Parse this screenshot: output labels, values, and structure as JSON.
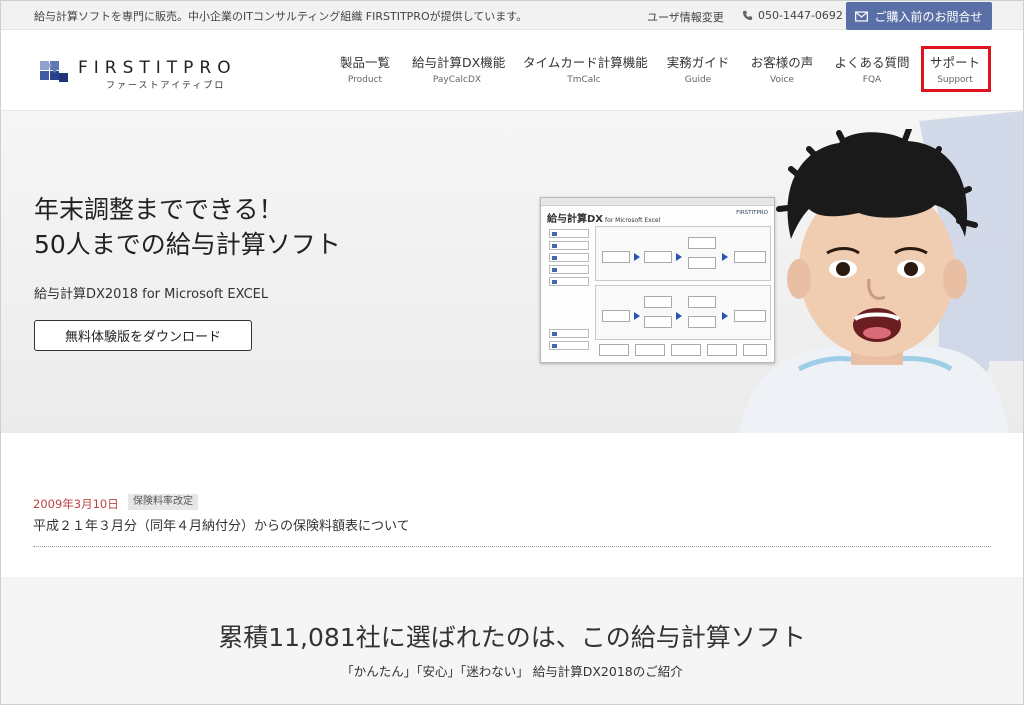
{
  "topbar": {
    "tagline": "給与計算ソフトを専門に販売。中小企業のITコンサルティング組織 FIRSTITPROが提供しています。",
    "user_info": "ユーザ情報変更",
    "phone": "050-1447-0692",
    "inquiry_button": "ご購入前のお問合せ"
  },
  "logo": {
    "brand": "FIRSTITPRO",
    "kana": "ファーストアイティプロ"
  },
  "nav": [
    {
      "jp": "製品一覧",
      "en": "Product"
    },
    {
      "jp": "給与計算DX機能",
      "en": "PayCalcDX"
    },
    {
      "jp": "タイムカード計算機能",
      "en": "TmCalc"
    },
    {
      "jp": "実務ガイド",
      "en": "Guide"
    },
    {
      "jp": "お客様の声",
      "en": "Voice"
    },
    {
      "jp": "よくある質問",
      "en": "FQA"
    },
    {
      "jp": "サポート",
      "en": "Support"
    }
  ],
  "hero": {
    "headline_1": "年末調整までできる！",
    "headline_2": "50人までの給与計算ソフト",
    "subtitle": "給与計算DX2018 for Microsoft EXCEL",
    "download_button": "無料体験版をダウンロード",
    "app_title": "給与計算DX",
    "app_title_sub": "for Microsoft Excel",
    "app_year": "2018"
  },
  "news": {
    "date": "2009年3月10日",
    "tag": "保険料率改定",
    "title": "平成２１年３月分（同年４月納付分）からの保険料額表について"
  },
  "section": {
    "heading": "累積11,081社に選ばれたのは、この給与計算ソフト",
    "tagline": "「かんたん」「安心」「迷わない」 給与計算DX2018のご紹介"
  },
  "colors": {
    "accent": "#5a6fa6",
    "highlight": "#e0141e",
    "news_date": "#b44444"
  }
}
